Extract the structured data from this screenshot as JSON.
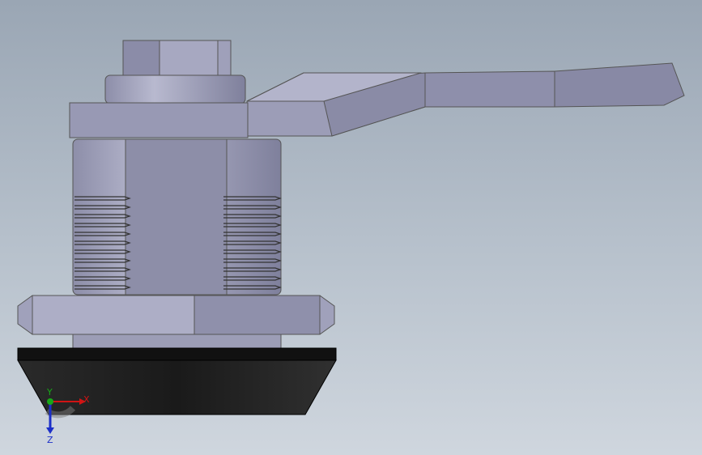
{
  "viewport": {
    "background_top": "#9aa6b4",
    "background_bottom": "#cfd6de"
  },
  "triad": {
    "x_label": "X",
    "y_label": "Y",
    "z_label": "Z",
    "x_color": "#d01414",
    "y_color": "#18a818",
    "z_color": "#1c2fc8"
  },
  "model": {
    "metal_color": "#8f90ae",
    "metal_light": "#b7b8cf",
    "rubber_color": "#1e1e1e"
  }
}
